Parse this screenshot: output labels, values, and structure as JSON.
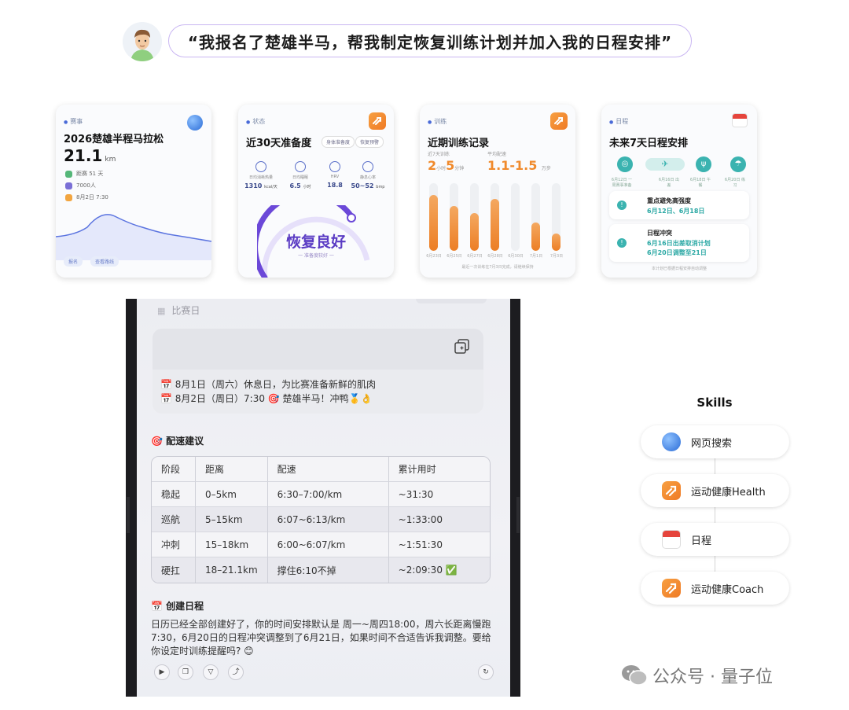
{
  "prompt": "“我报名了楚雄半马，帮我制定恢复训练计划并加入我的日程安排”",
  "cards": {
    "race": {
      "tag": "赛事",
      "title": "2026楚雄半程马拉松",
      "distance": "21.1",
      "unit": "km",
      "rows": [
        "距赛 51 天",
        "7000人",
        "8月2日 7:30"
      ],
      "pills": [
        "报名",
        "查看路线"
      ]
    },
    "status": {
      "tag": "状态",
      "title": "近30天准备度",
      "buttons": [
        "身体准备度",
        "恢复预警"
      ],
      "stats": [
        {
          "label": "日均消耗热量",
          "value": "1310",
          "unit": "kcal/天"
        },
        {
          "label": "日均睡眠",
          "value": "6.5",
          "unit": "小时"
        },
        {
          "label": "HRV",
          "value": "18.8",
          "unit": ""
        },
        {
          "label": "静息心率",
          "value": "50~52",
          "unit": "bmp"
        }
      ],
      "status_text": "恢复良好",
      "status_sub": "一 准备度较好 一"
    },
    "training": {
      "tag": "训练",
      "title": "近期训练记录",
      "metric1_label": "近7天训练",
      "metric1_value": "2",
      "metric1_unit1": "小时",
      "metric1_value2": "5",
      "metric1_unit2": "分钟",
      "metric2_label": "平均配速",
      "metric2_value": "1.1-1.5",
      "metric2_unit": "万步",
      "chart_data": {
        "type": "bar",
        "categories": [
          "6月23日",
          "6月25日",
          "6月27日",
          "6月28日",
          "6月30日",
          "7月1日",
          "7月3日"
        ],
        "values": [
          0.82,
          0.66,
          0.56,
          0.77,
          0,
          0.42,
          0.25
        ],
        "ylim": [
          0,
          1
        ]
      },
      "footer": "最近一次训练在7月3日完成，请继续保持"
    },
    "schedule": {
      "tag": "日程",
      "title": "未来7天日程安排",
      "timeline": [
        "6月12日 一周赛事准备",
        "6月16日 出差",
        "6月18日 午餐",
        "6月20日 练习"
      ],
      "box1_title": "重点避免高强度",
      "box1_value": "6月12日、6月18日",
      "box2_title": "日程冲突",
      "box2_line1": "6月16日出差取消计划",
      "box2_line2": "6月20日调整至21日",
      "footer": "本计划已根据日程安排自动调整"
    }
  },
  "phone": {
    "header": "比赛日",
    "lines": [
      "📅 8月1日（周六）休息日，为比赛准备新鲜的肌肉",
      "📅 8月2日（周日）7:30 🎯 楚雄半马！冲鸭🥇👌"
    ],
    "pace_title": "🎯 配速建议",
    "table": {
      "headers": [
        "阶段",
        "距离",
        "配速",
        "累计用时"
      ],
      "rows": [
        [
          "稳起",
          "0–5km",
          "6:30–7:00/km",
          "~31:30"
        ],
        [
          "巡航",
          "5–15km",
          "6:07~6:13/km",
          "~1:33:00"
        ],
        [
          "冲刺",
          "15–18km",
          "6:00~6:07/km",
          "~1:51:30"
        ],
        [
          "硬扛",
          "18–21.1km",
          "撑住6:10不掉",
          "~2:09:30 ✅"
        ]
      ]
    },
    "schedule_title": "📅 创建日程",
    "paragraph": "日历已经全部创建好了，你的时间安排默认是 周一~周四18:00，周六长距离慢跑7:30，6月20日的日程冲突调整到了6月21日，如果时间不合适告诉我调整。要给你设定时训练提醒吗? 😊"
  },
  "skills": {
    "title": "Skills",
    "items": [
      "网页搜索",
      "运动健康Health",
      "日程",
      "运动健康Coach"
    ]
  },
  "watermark": "公众号 · 量子位",
  "colors": {
    "accent_orange": "#f08a2c",
    "accent_purple": "#5b3cc4",
    "accent_teal": "#3bb3b0",
    "calendar_red": "#e5443c"
  }
}
